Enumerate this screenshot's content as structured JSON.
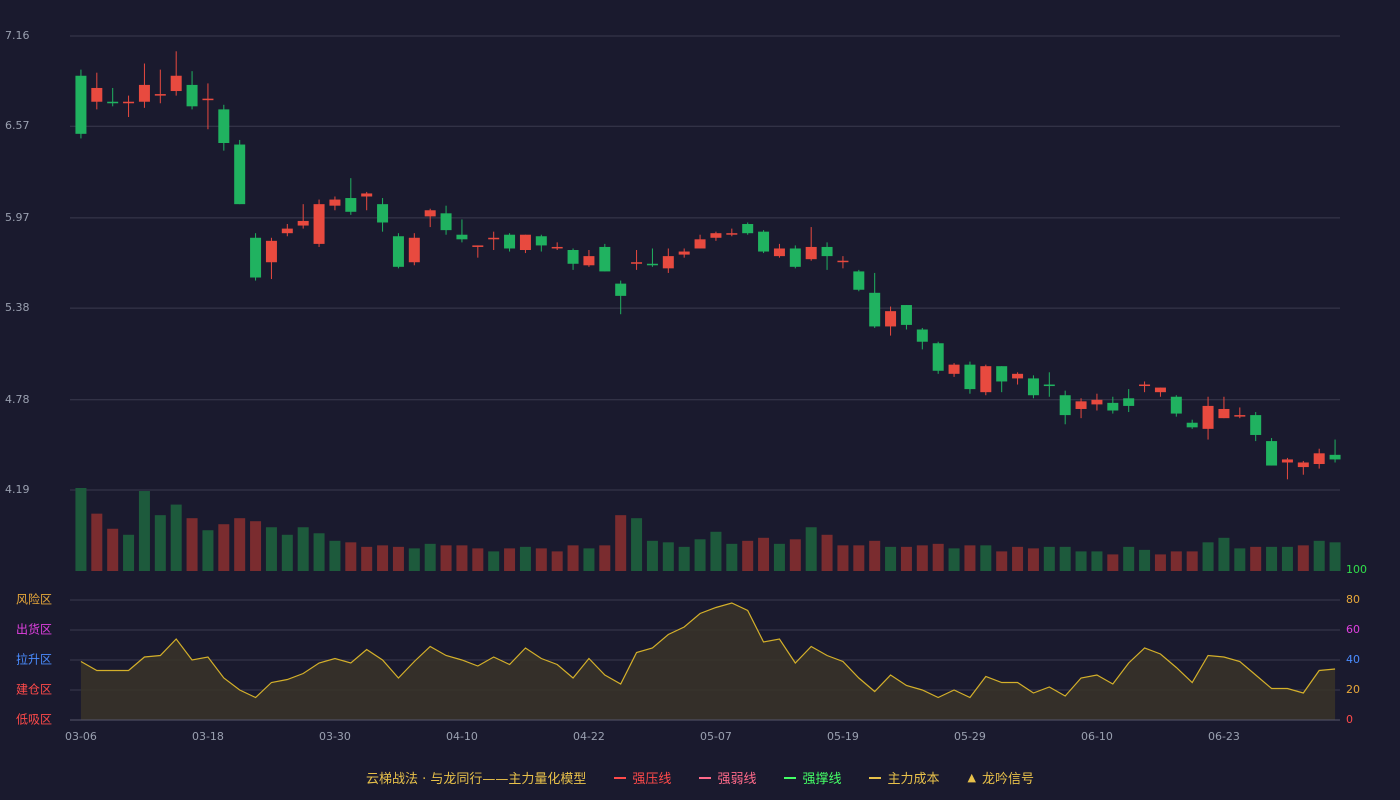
{
  "chart_data": {
    "type": "candlestick",
    "price_axis": {
      "ticks": [
        "7.16",
        "6.57",
        "5.97",
        "5.38",
        "4.78",
        "4.19"
      ],
      "ylim": [
        4.19,
        7.16
      ]
    },
    "x_ticks": [
      "03-06",
      "03-18",
      "03-30",
      "04-10",
      "04-22",
      "05-07",
      "05-19",
      "05-29",
      "06-10",
      "06-23"
    ],
    "candles": [
      [
        6.9,
        6.52,
        6.94,
        6.49
      ],
      [
        6.73,
        6.82,
        6.92,
        6.68
      ],
      [
        6.73,
        6.72,
        6.82,
        6.7
      ],
      [
        6.72,
        6.73,
        6.77,
        6.63
      ],
      [
        6.73,
        6.84,
        6.98,
        6.69
      ],
      [
        6.77,
        6.78,
        6.94,
        6.72
      ],
      [
        6.8,
        6.9,
        7.06,
        6.77
      ],
      [
        6.84,
        6.7,
        6.93,
        6.68
      ],
      [
        6.75,
        6.75,
        6.85,
        6.55
      ],
      [
        6.68,
        6.46,
        6.71,
        6.41
      ],
      [
        6.45,
        6.06,
        6.48,
        6.06
      ],
      [
        5.84,
        5.58,
        5.87,
        5.56
      ],
      [
        5.68,
        5.82,
        5.84,
        5.57
      ],
      [
        5.87,
        5.9,
        5.93,
        5.85
      ],
      [
        5.92,
        5.95,
        6.06,
        5.9
      ],
      [
        5.8,
        6.06,
        6.09,
        5.78
      ],
      [
        6.05,
        6.09,
        6.11,
        6.02
      ],
      [
        6.1,
        6.01,
        6.23,
        5.99
      ],
      [
        6.11,
        6.13,
        6.14,
        6.02
      ],
      [
        6.06,
        5.94,
        6.1,
        5.88
      ],
      [
        5.85,
        5.65,
        5.87,
        5.64
      ],
      [
        5.68,
        5.84,
        5.87,
        5.66
      ],
      [
        5.98,
        6.02,
        6.03,
        5.91
      ],
      [
        6.0,
        5.89,
        6.05,
        5.86
      ],
      [
        5.86,
        5.83,
        5.96,
        5.81
      ],
      [
        5.78,
        5.79,
        5.79,
        5.71
      ],
      [
        5.83,
        5.84,
        5.88,
        5.76
      ],
      [
        5.86,
        5.77,
        5.87,
        5.75
      ],
      [
        5.76,
        5.86,
        5.86,
        5.74
      ],
      [
        5.85,
        5.79,
        5.86,
        5.75
      ],
      [
        5.78,
        5.78,
        5.81,
        5.76
      ],
      [
        5.76,
        5.67,
        5.77,
        5.63
      ],
      [
        5.66,
        5.72,
        5.76,
        5.65
      ],
      [
        5.78,
        5.62,
        5.8,
        5.62
      ],
      [
        5.54,
        5.46,
        5.56,
        5.34
      ],
      [
        5.67,
        5.68,
        5.76,
        5.63
      ],
      [
        5.67,
        5.66,
        5.77,
        5.65
      ],
      [
        5.64,
        5.72,
        5.77,
        5.61
      ],
      [
        5.73,
        5.75,
        5.77,
        5.71
      ],
      [
        5.77,
        5.83,
        5.86,
        5.77
      ],
      [
        5.84,
        5.87,
        5.88,
        5.82
      ],
      [
        5.87,
        5.87,
        5.9,
        5.85
      ],
      [
        5.93,
        5.87,
        5.94,
        5.86
      ],
      [
        5.88,
        5.75,
        5.89,
        5.74
      ],
      [
        5.72,
        5.77,
        5.8,
        5.71
      ],
      [
        5.77,
        5.65,
        5.79,
        5.64
      ],
      [
        5.7,
        5.78,
        5.91,
        5.69
      ],
      [
        5.78,
        5.72,
        5.81,
        5.63
      ],
      [
        5.69,
        5.69,
        5.72,
        5.64
      ],
      [
        5.62,
        5.5,
        5.63,
        5.49
      ],
      [
        5.48,
        5.26,
        5.61,
        5.25
      ],
      [
        5.26,
        5.36,
        5.39,
        5.2
      ],
      [
        5.4,
        5.27,
        5.4,
        5.24
      ],
      [
        5.24,
        5.16,
        5.25,
        5.11
      ],
      [
        5.15,
        4.97,
        5.16,
        4.95
      ],
      [
        4.95,
        5.01,
        5.02,
        4.93
      ],
      [
        5.01,
        4.85,
        5.03,
        4.82
      ],
      [
        4.83,
        5.0,
        5.01,
        4.81
      ],
      [
        5.0,
        4.9,
        5.0,
        4.83
      ],
      [
        4.92,
        4.95,
        4.96,
        4.88
      ],
      [
        4.92,
        4.81,
        4.94,
        4.79
      ],
      [
        4.88,
        4.87,
        4.96,
        4.8
      ],
      [
        4.81,
        4.68,
        4.84,
        4.62
      ],
      [
        4.72,
        4.77,
        4.79,
        4.66
      ],
      [
        4.75,
        4.78,
        4.82,
        4.71
      ],
      [
        4.76,
        4.71,
        4.8,
        4.69
      ],
      [
        4.79,
        4.74,
        4.85,
        4.7
      ],
      [
        4.88,
        4.88,
        4.9,
        4.83
      ],
      [
        4.83,
        4.86,
        4.86,
        4.8
      ],
      [
        4.8,
        4.69,
        4.81,
        4.67
      ],
      [
        4.63,
        4.6,
        4.65,
        4.59
      ],
      [
        4.59,
        4.74,
        4.8,
        4.52
      ],
      [
        4.66,
        4.72,
        4.8,
        4.66
      ],
      [
        4.68,
        4.68,
        4.73,
        4.66
      ],
      [
        4.68,
        4.55,
        4.7,
        4.51
      ],
      [
        4.51,
        4.35,
        4.53,
        4.35
      ],
      [
        4.37,
        4.39,
        4.4,
        4.26
      ],
      [
        4.34,
        4.37,
        4.38,
        4.29
      ],
      [
        4.36,
        4.43,
        4.46,
        4.33
      ],
      [
        4.42,
        4.39,
        4.52,
        4.37
      ]
    ],
    "volume": [
      [
        55,
        "g"
      ],
      [
        38,
        "r"
      ],
      [
        28,
        "r"
      ],
      [
        24,
        "g"
      ],
      [
        53,
        "g"
      ],
      [
        37,
        "g"
      ],
      [
        44,
        "g"
      ],
      [
        35,
        "r"
      ],
      [
        27,
        "g"
      ],
      [
        31,
        "r"
      ],
      [
        35,
        "r"
      ],
      [
        33,
        "r"
      ],
      [
        29,
        "g"
      ],
      [
        24,
        "g"
      ],
      [
        29,
        "g"
      ],
      [
        25,
        "g"
      ],
      [
        20,
        "g"
      ],
      [
        19,
        "r"
      ],
      [
        16,
        "r"
      ],
      [
        17,
        "r"
      ],
      [
        16,
        "r"
      ],
      [
        15,
        "g"
      ],
      [
        18,
        "g"
      ],
      [
        17,
        "r"
      ],
      [
        17,
        "r"
      ],
      [
        15,
        "r"
      ],
      [
        13,
        "g"
      ],
      [
        15,
        "r"
      ],
      [
        16,
        "g"
      ],
      [
        15,
        "r"
      ],
      [
        13,
        "r"
      ],
      [
        17,
        "r"
      ],
      [
        15,
        "g"
      ],
      [
        17,
        "r"
      ],
      [
        37,
        "r"
      ],
      [
        35,
        "g"
      ],
      [
        20,
        "g"
      ],
      [
        19,
        "g"
      ],
      [
        16,
        "g"
      ],
      [
        21,
        "g"
      ],
      [
        26,
        "g"
      ],
      [
        18,
        "g"
      ],
      [
        20,
        "r"
      ],
      [
        22,
        "r"
      ],
      [
        18,
        "g"
      ],
      [
        21,
        "r"
      ],
      [
        29,
        "g"
      ],
      [
        24,
        "r"
      ],
      [
        17,
        "r"
      ],
      [
        17,
        "r"
      ],
      [
        20,
        "r"
      ],
      [
        16,
        "g"
      ],
      [
        16,
        "r"
      ],
      [
        17,
        "r"
      ],
      [
        18,
        "r"
      ],
      [
        15,
        "g"
      ],
      [
        17,
        "r"
      ],
      [
        17,
        "g"
      ],
      [
        13,
        "r"
      ],
      [
        16,
        "r"
      ],
      [
        15,
        "r"
      ],
      [
        16,
        "g"
      ],
      [
        16,
        "g"
      ],
      [
        13,
        "g"
      ],
      [
        13,
        "g"
      ],
      [
        11,
        "r"
      ],
      [
        16,
        "g"
      ],
      [
        14,
        "g"
      ],
      [
        11,
        "r"
      ],
      [
        13,
        "r"
      ],
      [
        13,
        "r"
      ],
      [
        19,
        "g"
      ],
      [
        22,
        "g"
      ],
      [
        15,
        "g"
      ],
      [
        16,
        "r"
      ],
      [
        16,
        "g"
      ],
      [
        16,
        "g"
      ],
      [
        17,
        "r"
      ],
      [
        20,
        "g"
      ],
      [
        19,
        "g"
      ]
    ],
    "indicator": {
      "zones": [
        "风险区",
        "出货区",
        "拉升区",
        "建仓区",
        "低吸区"
      ],
      "zone_colors": [
        "#e8a83a",
        "#e040e0",
        "#4a8cff",
        "#ff4a4a",
        "#ff4a4a"
      ],
      "ticks": [
        "100",
        "80",
        "60",
        "40",
        "20",
        "0"
      ],
      "tick_colors": [
        "#2fe04a",
        "#e8a83a",
        "#e040e0",
        "#4a8cff",
        "#e8a83a",
        "#ff4a4a"
      ],
      "ylim": [
        0,
        100
      ],
      "values": [
        39,
        33,
        33,
        33,
        42,
        43,
        54,
        40,
        42,
        28,
        20,
        15,
        25,
        27,
        31,
        38,
        41,
        38,
        47,
        40,
        28,
        39,
        49,
        43,
        40,
        36,
        42,
        37,
        48,
        41,
        37,
        28,
        41,
        30,
        24,
        45,
        48,
        57,
        62,
        71,
        75,
        78,
        73,
        52,
        54,
        38,
        49,
        43,
        39,
        28,
        19,
        30,
        23,
        20,
        15,
        20,
        15,
        29,
        25,
        25,
        18,
        22,
        16,
        28,
        30,
        24,
        38,
        48,
        44,
        35,
        25,
        43,
        42,
        39,
        30,
        21,
        21,
        18,
        33,
        34
      ]
    },
    "grid": true
  },
  "legend": {
    "title": "云梯战法 · 与龙同行——主力量化模型",
    "items": [
      {
        "label": "强压线",
        "color": "#ff4a4a",
        "style": "solid"
      },
      {
        "label": "强弱线",
        "color": "#ff6a8a",
        "style": "dashed"
      },
      {
        "label": "强撑线",
        "color": "#44ff66",
        "style": "solid"
      },
      {
        "label": "主力成本",
        "color": "#e8c14a",
        "style": "dashed"
      },
      {
        "label": "龙吟信号",
        "color": "#e8c14a",
        "style": "triangle",
        "symbol": "▲"
      }
    ]
  },
  "colors": {
    "background": "#1a1a2e",
    "up": "#e84a3f",
    "down": "#20b260",
    "volume_up": "#7a2c2f",
    "volume_down": "#1d5a3c",
    "indicator_line": "#d4b02a",
    "indicator_fill": "#3a3428",
    "grid": "#3a3a4e",
    "axis_text": "#9aa0b0"
  }
}
